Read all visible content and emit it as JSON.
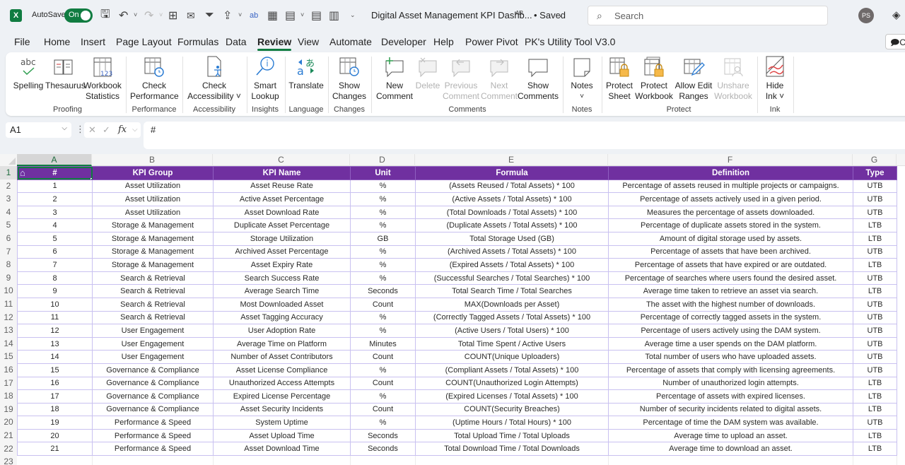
{
  "titlebar": {
    "app_icon": "excel-icon",
    "autosave_label": "AutoSave",
    "autosave_state": "On",
    "doc_title": "Digital Asset Management KPI Dashb...",
    "save_status": "• Saved",
    "search_placeholder": "Search",
    "user_initials": "PS",
    "quick_access": [
      "save-sync-icon",
      "undo-icon",
      "redo-icon",
      "borders-icon",
      "email-icon",
      "clear-filter-icon",
      "share-icon",
      "spelling-icon",
      "table-icon",
      "calculator-icon",
      "calculator-icon",
      "filter-form-icon",
      "customize-icon"
    ]
  },
  "tabs": [
    "File",
    "Home",
    "Insert",
    "Page Layout",
    "Formulas",
    "Data",
    "Review",
    "View",
    "Automate",
    "Developer",
    "Help",
    "Power Pivot",
    "PK's Utility Tool V3.0"
  ],
  "active_tab": "Review",
  "comments_button": "C",
  "ribbon": {
    "groups": [
      {
        "label": "Proofing",
        "buttons": [
          {
            "label1": "Spelling",
            "label2": "",
            "icon": "spelling-abc-icon",
            "disabled": false
          },
          {
            "label1": "Thesaurus",
            "label2": "",
            "icon": "thesaurus-book-icon",
            "disabled": false
          },
          {
            "label1": "Workbook",
            "label2": "Statistics",
            "icon": "workbook-statistics-icon",
            "disabled": false
          }
        ]
      },
      {
        "label": "Performance",
        "buttons": [
          {
            "label1": "Check",
            "label2": "Performance",
            "icon": "check-performance-icon",
            "disabled": false
          }
        ]
      },
      {
        "label": "Accessibility",
        "buttons": [
          {
            "label1": "Check",
            "label2": "Accessibility ˅",
            "icon": "check-accessibility-icon",
            "disabled": false
          }
        ]
      },
      {
        "label": "Insights",
        "buttons": [
          {
            "label1": "Smart",
            "label2": "Lookup",
            "icon": "smart-lookup-icon",
            "disabled": false
          }
        ]
      },
      {
        "label": "Language",
        "buttons": [
          {
            "label1": "Translate",
            "label2": "",
            "icon": "translate-icon",
            "disabled": false
          }
        ]
      },
      {
        "label": "Changes",
        "buttons": [
          {
            "label1": "Show",
            "label2": "Changes",
            "icon": "show-changes-icon",
            "disabled": false
          }
        ]
      },
      {
        "label": "Comments",
        "buttons": [
          {
            "label1": "New",
            "label2": "Comment",
            "icon": "new-comment-icon",
            "disabled": false
          },
          {
            "label1": "Delete",
            "label2": "",
            "icon": "delete-comment-icon",
            "disabled": true
          },
          {
            "label1": "Previous",
            "label2": "Comment",
            "icon": "previous-comment-icon",
            "disabled": true
          },
          {
            "label1": "Next",
            "label2": "Comment",
            "icon": "next-comment-icon",
            "disabled": true
          },
          {
            "label1": "Show",
            "label2": "Comments",
            "icon": "show-comments-icon",
            "disabled": false
          }
        ]
      },
      {
        "label": "Notes",
        "buttons": [
          {
            "label1": "Notes",
            "label2": "˅",
            "icon": "notes-icon",
            "disabled": false
          }
        ]
      },
      {
        "label": "Protect",
        "buttons": [
          {
            "label1": "Protect",
            "label2": "Sheet",
            "icon": "protect-sheet-icon",
            "disabled": false
          },
          {
            "label1": "Protect",
            "label2": "Workbook",
            "icon": "protect-workbook-icon",
            "disabled": false
          },
          {
            "label1": "Allow Edit",
            "label2": "Ranges",
            "icon": "allow-edit-ranges-icon",
            "disabled": false
          },
          {
            "label1": "Unshare",
            "label2": "Workbook",
            "icon": "unshare-workbook-icon",
            "disabled": true
          }
        ]
      },
      {
        "label": "Ink",
        "buttons": [
          {
            "label1": "Hide",
            "label2": "Ink ˅",
            "icon": "hide-ink-icon",
            "disabled": false
          }
        ]
      }
    ]
  },
  "formula_bar": {
    "name_box": "A1",
    "formula": "#"
  },
  "sheet": {
    "column_letters": [
      "A",
      "B",
      "C",
      "D",
      "E",
      "F",
      "G"
    ],
    "selected_cell": "A1",
    "headers": [
      "#",
      "KPI Group",
      "KPI Name",
      "Unit",
      "Formula",
      "Definition",
      "Type"
    ],
    "rows": [
      [
        "1",
        "Asset Utilization",
        "Asset Reuse Rate",
        "%",
        "(Assets Reused / Total Assets) * 100",
        "Percentage of assets reused in multiple projects or campaigns.",
        "UTB"
      ],
      [
        "2",
        "Asset Utilization",
        "Active Asset Percentage",
        "%",
        "(Active Assets / Total Assets) * 100",
        "Percentage of assets actively used in a given period.",
        "UTB"
      ],
      [
        "3",
        "Asset Utilization",
        "Asset Download Rate",
        "%",
        "(Total Downloads / Total Assets) * 100",
        "Measures the percentage of assets downloaded.",
        "UTB"
      ],
      [
        "4",
        "Storage & Management",
        "Duplicate Asset Percentage",
        "%",
        "(Duplicate Assets / Total Assets) * 100",
        "Percentage of duplicate assets stored in the system.",
        "LTB"
      ],
      [
        "5",
        "Storage & Management",
        "Storage Utilization",
        "GB",
        "Total Storage Used (GB)",
        "Amount of digital storage used by assets.",
        "LTB"
      ],
      [
        "6",
        "Storage & Management",
        "Archived Asset Percentage",
        "%",
        "(Archived Assets / Total Assets) * 100",
        "Percentage of assets that have been archived.",
        "UTB"
      ],
      [
        "7",
        "Storage & Management",
        "Asset Expiry Rate",
        "%",
        "(Expired Assets / Total Assets) * 100",
        "Percentage of assets that have expired or are outdated.",
        "LTB"
      ],
      [
        "8",
        "Search & Retrieval",
        "Search Success Rate",
        "%",
        "(Successful Searches / Total Searches) * 100",
        "Percentage of searches where users found the desired asset.",
        "UTB"
      ],
      [
        "9",
        "Search & Retrieval",
        "Average Search Time",
        "Seconds",
        "Total Search Time / Total Searches",
        "Average time taken to retrieve an asset via search.",
        "LTB"
      ],
      [
        "10",
        "Search & Retrieval",
        "Most Downloaded Asset",
        "Count",
        "MAX(Downloads per Asset)",
        "The asset with the highest number of downloads.",
        "UTB"
      ],
      [
        "11",
        "Search & Retrieval",
        "Asset Tagging Accuracy",
        "%",
        "(Correctly Tagged Assets / Total Assets) * 100",
        "Percentage of correctly tagged assets in the system.",
        "UTB"
      ],
      [
        "12",
        "User Engagement",
        "User Adoption Rate",
        "%",
        "(Active Users / Total Users) * 100",
        "Percentage of users actively using the DAM system.",
        "UTB"
      ],
      [
        "13",
        "User Engagement",
        "Average Time on Platform",
        "Minutes",
        "Total Time Spent / Active Users",
        "Average time a user spends on the DAM platform.",
        "UTB"
      ],
      [
        "14",
        "User Engagement",
        "Number of Asset Contributors",
        "Count",
        "COUNT(Unique Uploaders)",
        "Total number of users who have uploaded assets.",
        "UTB"
      ],
      [
        "15",
        "Governance & Compliance",
        "Asset License Compliance",
        "%",
        "(Compliant Assets / Total Assets) * 100",
        "Percentage of assets that comply with licensing agreements.",
        "UTB"
      ],
      [
        "16",
        "Governance & Compliance",
        "Unauthorized Access Attempts",
        "Count",
        "COUNT(Unauthorized Login Attempts)",
        "Number of unauthorized login attempts.",
        "LTB"
      ],
      [
        "17",
        "Governance & Compliance",
        "Expired License Percentage",
        "%",
        "(Expired Licenses / Total Assets) * 100",
        "Percentage of assets with expired licenses.",
        "LTB"
      ],
      [
        "18",
        "Governance & Compliance",
        "Asset Security Incidents",
        "Count",
        "COUNT(Security Breaches)",
        "Number of security incidents related to digital assets.",
        "LTB"
      ],
      [
        "19",
        "Performance & Speed",
        "System Uptime",
        "%",
        "(Uptime Hours / Total Hours) * 100",
        "Percentage of time the DAM system was available.",
        "UTB"
      ],
      [
        "20",
        "Performance & Speed",
        "Asset Upload Time",
        "Seconds",
        "Total Upload Time / Total Uploads",
        "Average time to upload an asset.",
        "LTB"
      ],
      [
        "21",
        "Performance & Speed",
        "Asset Download Time",
        "Seconds",
        "Total Download Time / Total Downloads",
        "Average time to download an asset.",
        "LTB"
      ]
    ]
  },
  "colors": {
    "header_fill": "#7030a0",
    "header_text": "#ffffff",
    "grid_border": "#c9c1f0",
    "accent": "#107c41"
  }
}
